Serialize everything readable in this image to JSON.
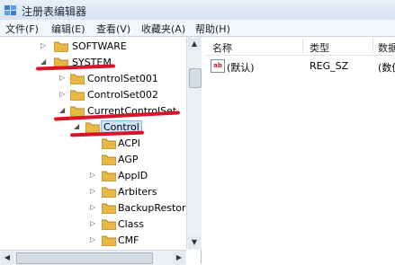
{
  "window": {
    "title": "注册表编辑器"
  },
  "menu": [
    "文件(F)",
    "编辑(E)",
    "查看(V)",
    "收藏夹(A)",
    "帮助(H)"
  ],
  "tree": [
    {
      "label": "SOFTWARE",
      "arrow": "▷"
    },
    {
      "label": "SYSTEM",
      "arrow": "◢"
    },
    {
      "label": "ControlSet001",
      "arrow": "▷"
    },
    {
      "label": "ControlSet002",
      "arrow": "▷"
    },
    {
      "label": "CurrentControlSet",
      "arrow": "◢"
    },
    {
      "label": "Control",
      "arrow": "◢",
      "selected": true
    },
    {
      "label": "ACPI",
      "arrow": ""
    },
    {
      "label": "AGP",
      "arrow": ""
    },
    {
      "label": "AppID",
      "arrow": "▷"
    },
    {
      "label": "Arbiters",
      "arrow": "▷"
    },
    {
      "label": "BackupRestore",
      "arrow": "▷"
    },
    {
      "label": "Class",
      "arrow": "▷"
    },
    {
      "label": "CMF",
      "arrow": "▷"
    }
  ],
  "list": {
    "headers": [
      "名称",
      "类型",
      "数据"
    ],
    "rows": [
      {
        "name": "(默认)",
        "type": "REG_SZ",
        "data": "(数值"
      }
    ]
  },
  "colors": {
    "annotation": "#d8132a",
    "folder": "#e8b845",
    "selection": "#cce4fb"
  },
  "icons": {
    "app": "registry-editor-icon",
    "value": "string-value-icon",
    "folder": "folder-icon"
  }
}
